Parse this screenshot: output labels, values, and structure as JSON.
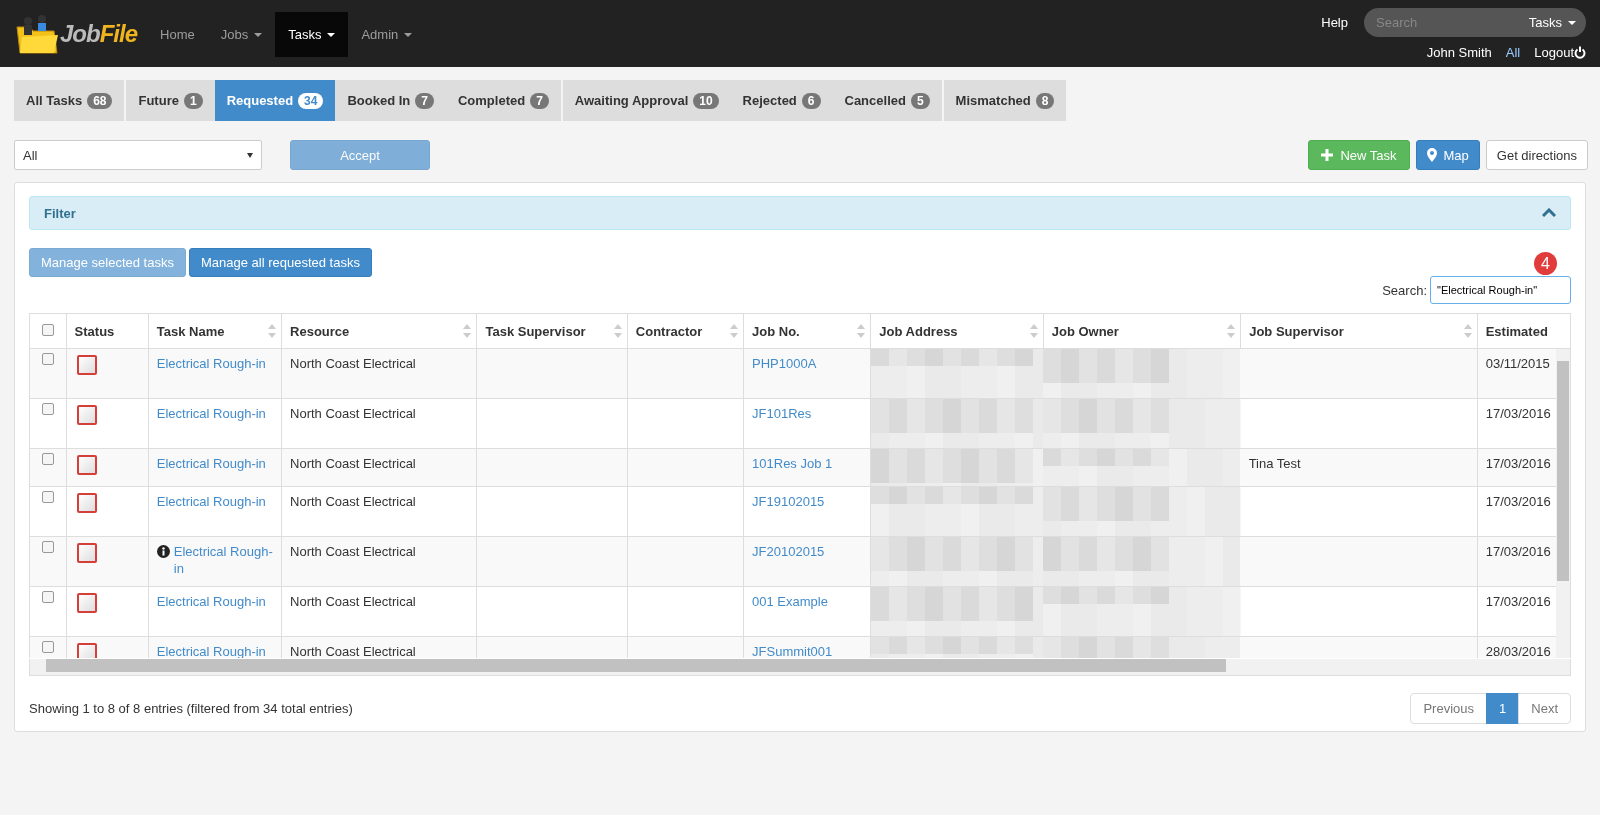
{
  "navbar": {
    "logo": {
      "part1": "Job",
      "part2": "File"
    },
    "items": [
      {
        "label": "Home",
        "dropdown": false,
        "selected": false
      },
      {
        "label": "Jobs",
        "dropdown": true,
        "selected": false
      },
      {
        "label": "Tasks",
        "dropdown": true,
        "selected": true
      },
      {
        "label": "Admin",
        "dropdown": true,
        "selected": false
      }
    ],
    "help": "Help",
    "search": {
      "placeholder": "Search",
      "scope": "Tasks"
    },
    "user": "John Smith",
    "all": "All",
    "logout": "Logout"
  },
  "tab_groups": [
    {
      "tabs": [
        {
          "label": "All Tasks",
          "count": "68",
          "selected": false
        }
      ]
    },
    {
      "tabs": [
        {
          "label": "Future",
          "count": "1",
          "selected": false
        },
        {
          "label": "Requested",
          "count": "34",
          "selected": true
        },
        {
          "label": "Booked In",
          "count": "7",
          "selected": false
        },
        {
          "label": "Completed",
          "count": "7",
          "selected": false
        }
      ]
    },
    {
      "tabs": [
        {
          "label": "Awaiting Approval",
          "count": "10",
          "selected": false
        },
        {
          "label": "Rejected",
          "count": "6",
          "selected": false
        },
        {
          "label": "Cancelled",
          "count": "5",
          "selected": false
        }
      ]
    },
    {
      "tabs": [
        {
          "label": "Mismatched",
          "count": "8",
          "selected": false
        }
      ]
    }
  ],
  "status_select": {
    "value": "All"
  },
  "accept_button": {
    "label": "Accept",
    "disabled": true
  },
  "action_buttons": [
    {
      "kind": "new",
      "label": "New Task"
    },
    {
      "kind": "map",
      "label": "Map"
    },
    {
      "kind": "plain",
      "label": "Get directions"
    }
  ],
  "filter": {
    "title": "Filter",
    "expanded": false
  },
  "manage_buttons": [
    {
      "label": "Manage selected tasks",
      "disabled": true
    },
    {
      "label": "Manage all requested tasks",
      "disabled": false
    }
  ],
  "table_search": {
    "label": "Search:",
    "value": "\"Electrical Rough-in\"",
    "badge": "4"
  },
  "table": {
    "select_all": {
      "checked": false
    },
    "columns": [
      {
        "label": "Status",
        "sortable": false
      },
      {
        "label": "Task Name",
        "sortable": true
      },
      {
        "label": "Resource",
        "sortable": true
      },
      {
        "label": "Task Supervisor",
        "sortable": true
      },
      {
        "label": "Contractor",
        "sortable": true
      },
      {
        "label": "Job No.",
        "sortable": true
      },
      {
        "label": "Job Address",
        "sortable": true
      },
      {
        "label": "Job Owner",
        "sortable": true
      },
      {
        "label": "Job Supervisor",
        "sortable": true
      },
      {
        "label": "Estimated",
        "sortable": false
      }
    ],
    "rows": [
      {
        "checked": false,
        "info": false,
        "task": "Electrical Rough-in",
        "resource": "North Coast Electrical",
        "task_supervisor": "",
        "contractor": "",
        "job_no": "PHP1000A",
        "job_supervisor": "",
        "estimated": "03/11/2015"
      },
      {
        "checked": false,
        "info": false,
        "task": "Electrical Rough-in",
        "resource": "North Coast Electrical",
        "task_supervisor": "",
        "contractor": "",
        "job_no": "JF101Res",
        "job_supervisor": "",
        "estimated": "17/03/2016"
      },
      {
        "checked": false,
        "info": false,
        "task": "Electrical Rough-in",
        "resource": "North Coast Electrical",
        "task_supervisor": "",
        "contractor": "",
        "job_no": "101Res Job 1",
        "job_supervisor": "Tina Test",
        "estimated": "17/03/2016"
      },
      {
        "checked": false,
        "info": false,
        "task": "Electrical Rough-in",
        "resource": "North Coast Electrical",
        "task_supervisor": "",
        "contractor": "",
        "job_no": "JF19102015",
        "job_supervisor": "",
        "estimated": "17/03/2016"
      },
      {
        "checked": false,
        "info": true,
        "task": "Electrical Rough-in",
        "resource": "North Coast Electrical",
        "task_supervisor": "",
        "contractor": "",
        "job_no": "JF20102015",
        "job_supervisor": "",
        "estimated": "17/03/2016"
      },
      {
        "checked": false,
        "info": false,
        "task": "Electrical Rough-in",
        "resource": "North Coast Electrical",
        "task_supervisor": "",
        "contractor": "",
        "job_no": "001 Example",
        "job_supervisor": "",
        "estimated": "17/03/2016"
      },
      {
        "checked": false,
        "info": false,
        "task": "Electrical Rough-in",
        "resource": "North Coast Electrical",
        "task_supervisor": "",
        "contractor": "",
        "job_no": "JFSummit001",
        "job_supervisor": "",
        "estimated": "28/03/2016"
      }
    ]
  },
  "footer": {
    "info": "Showing 1 to 8 of 8 entries (filtered from 34 total entries)",
    "pages": [
      {
        "label": "Previous",
        "kind": "prev",
        "selected": false
      },
      {
        "label": "1",
        "kind": "page",
        "selected": true
      },
      {
        "label": "Next",
        "kind": "next",
        "selected": false
      }
    ]
  }
}
